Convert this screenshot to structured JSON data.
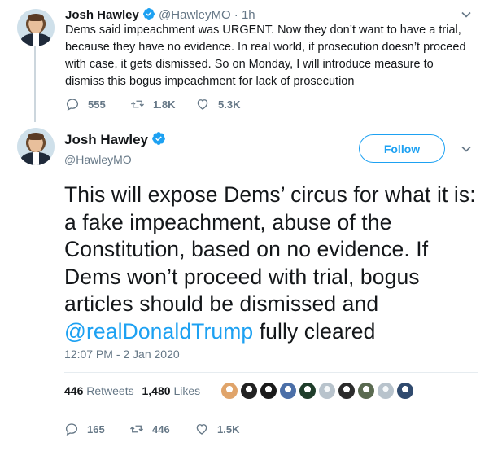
{
  "parent_tweet": {
    "name": "Josh Hawley",
    "handle": "@HawleyMO",
    "separator": "·",
    "time": "1h",
    "text": "Dems said impeachment was URGENT. Now they don’t want to have a trial, because they have no evidence. In real world, if prosecution doesn’t proceed with case, it gets dismissed. So on Monday, I will introduce measure to dismiss this bogus impeachment for lack of prosecution",
    "replies": "555",
    "retweets": "1.8K",
    "likes": "5.3K"
  },
  "main_tweet": {
    "name": "Josh Hawley",
    "handle": "@HawleyMO",
    "follow_label": "Follow",
    "text_before": "This will expose Dems’ circus for what it is: a fake impeachment, abuse of the Constitution, based on no evidence. If Dems won’t proceed with trial, bogus articles should be dismissed and ",
    "mention": "@realDonaldTrump",
    "text_after": " fully cleared",
    "timestamp": "12:07 PM - 2 Jan 2020",
    "retweets_count": "446",
    "retweets_label": "Retweets",
    "likes_count": "1,480",
    "likes_label": "Likes",
    "replies": "165",
    "retweets": "446",
    "likes": "1.5K"
  },
  "likers": [
    {
      "icon": "avatar-bitmoji",
      "color": "#e0a46a"
    },
    {
      "icon": "avatar-dark-circle",
      "color": "#222222"
    },
    {
      "icon": "avatar-text-logo",
      "color": "#1a1a1a"
    },
    {
      "icon": "avatar-person",
      "color": "#4b6fa8"
    },
    {
      "icon": "avatar-green-logo",
      "color": "#1f3d2a"
    },
    {
      "icon": "avatar-default",
      "color": "#b8c3cc"
    },
    {
      "icon": "avatar-tnba-logo",
      "color": "#2b2b2b"
    },
    {
      "icon": "avatar-landscape",
      "color": "#5a6a50"
    },
    {
      "icon": "avatar-default",
      "color": "#b8c3cc"
    },
    {
      "icon": "avatar-person-blue",
      "color": "#304a6e"
    }
  ],
  "colors": {
    "accent": "#1da1f2",
    "muted": "#657786",
    "text": "#14171a",
    "divider": "#e6ecf0"
  }
}
